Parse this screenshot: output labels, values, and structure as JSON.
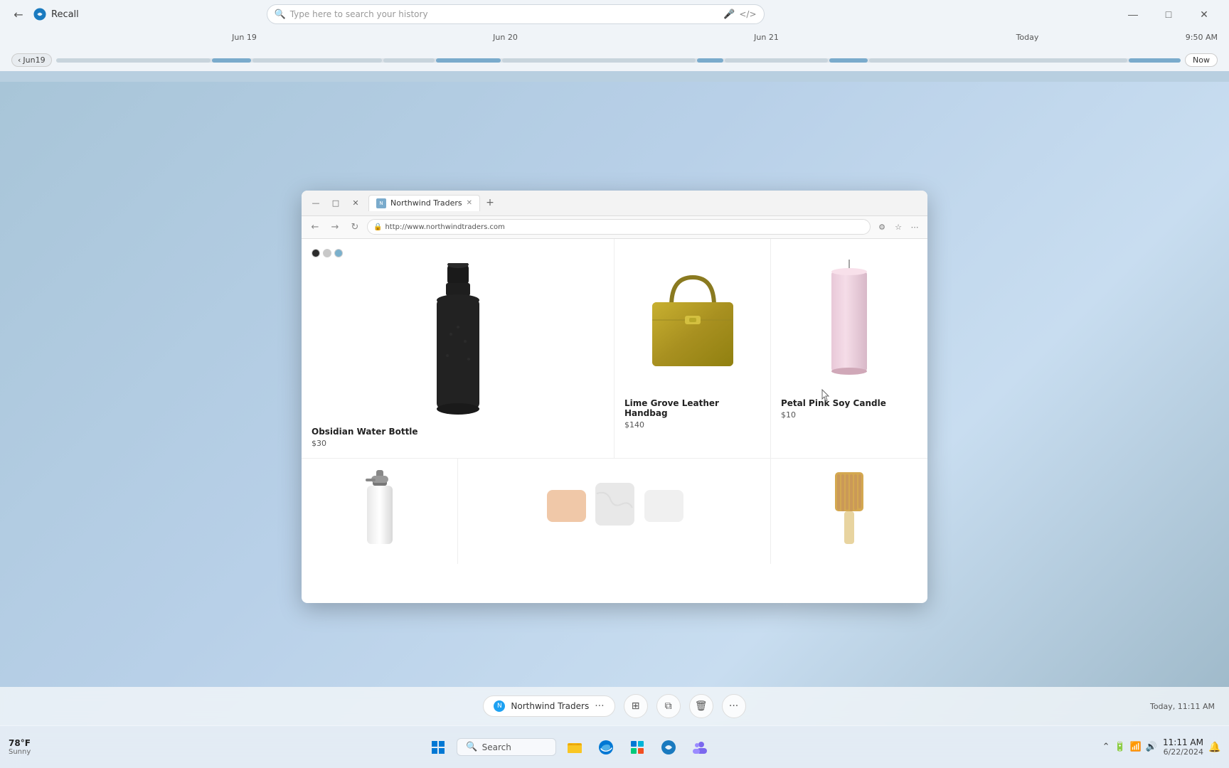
{
  "app": {
    "title": "Recall",
    "back_label": "←"
  },
  "searchbar": {
    "placeholder": "Type here to search your history",
    "mic_icon": "🎤",
    "code_icon": "</>",
    "search_icon": "🔍"
  },
  "window_controls": {
    "minimize": "—",
    "maximize": "□",
    "close": "✕"
  },
  "timeline": {
    "labels": [
      "Jun 19",
      "Jun 20",
      "Jun 21",
      "Today"
    ],
    "time": "9:50 AM",
    "back_label": "Jun19",
    "now_label": "Now"
  },
  "browser": {
    "tab_title": "Northwind Traders",
    "url": "http://www.northwindtraders.com",
    "new_tab": "+",
    "back": "←",
    "forward": "→",
    "refresh": "↻"
  },
  "products": {
    "row1": [
      {
        "name": "Obsidian Water Bottle",
        "price": "$30",
        "has_swatches": true,
        "swatches": [
          "#2c2c2c",
          "#c8c8c8",
          "#7ab0cc"
        ]
      },
      {
        "name": "Lime Grove Leather Handbag",
        "price": "$140",
        "has_swatches": false
      },
      {
        "name": "Petal Pink Soy Candle",
        "price": "$10",
        "has_swatches": false
      }
    ],
    "row2": [
      {
        "name": "Lotion",
        "price": ""
      },
      {
        "name": "Soap Collection",
        "price": ""
      },
      {
        "name": "Brush",
        "price": ""
      }
    ]
  },
  "snapshot": {
    "pill_label": "Northwind Traders",
    "pill_dots": "···",
    "timestamp": "Today, 11:11 AM",
    "action_screenshot": "⊞",
    "action_copy": "⧉",
    "action_delete": "🗑",
    "action_more": "···"
  },
  "taskbar": {
    "weather_temp": "78°F",
    "weather_condition": "Sunny",
    "search_label": "Search",
    "time": "11:11 AM",
    "date": "6/22/2024",
    "start_icon": "⊞"
  }
}
